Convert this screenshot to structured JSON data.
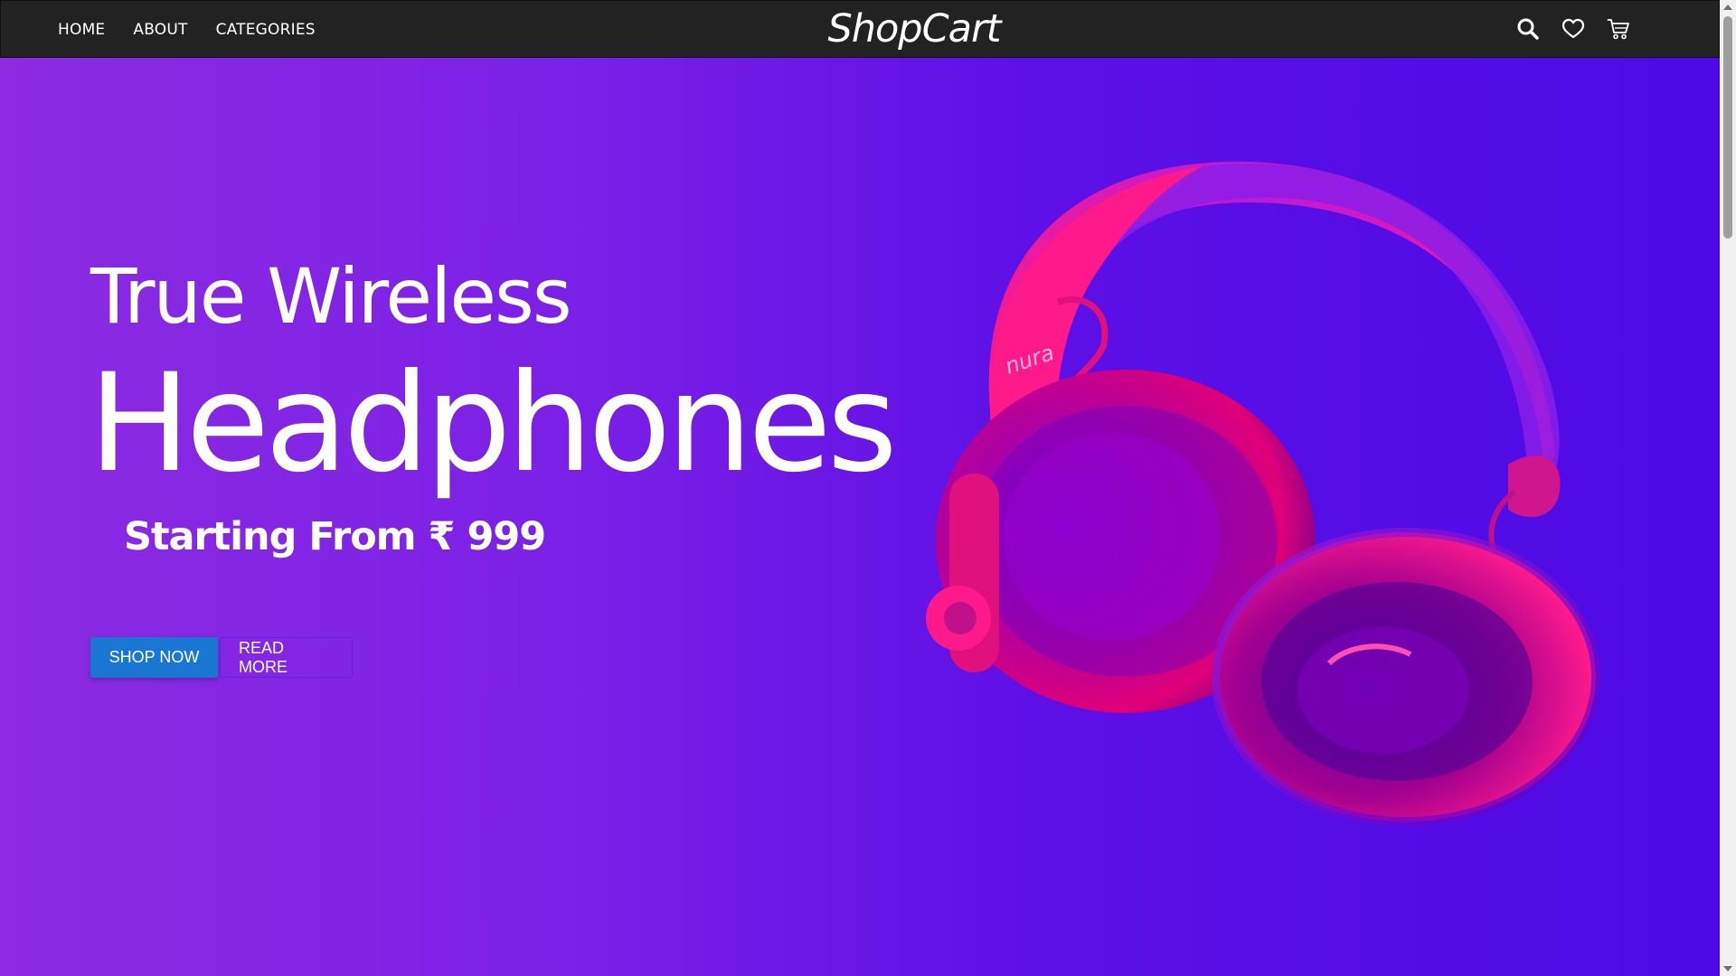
{
  "navbar": {
    "links": [
      {
        "label": "HOME"
      },
      {
        "label": "ABOUT"
      },
      {
        "label": "CATEGORIES"
      }
    ],
    "brand": "ShopCart",
    "icons": [
      "search-icon",
      "heart-icon",
      "cart-icon"
    ]
  },
  "hero": {
    "subtitle": "True Wireless",
    "title": "Headphones",
    "price": "Starting From ₹ 999",
    "primary_button": "SHOP NOW",
    "secondary_button": "READ MORE",
    "product_logo": "nura"
  },
  "colors": {
    "navbar": "#222222",
    "hero_gradient_start": "#8c2be2",
    "hero_gradient_end": "#4d0ae6",
    "primary_button": "#1976d2",
    "headphones": "#ff1a8c"
  }
}
